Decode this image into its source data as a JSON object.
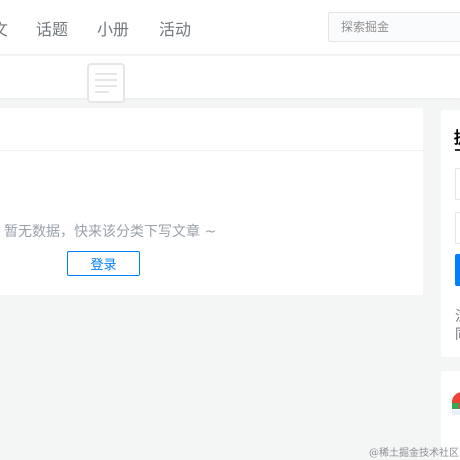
{
  "nav": {
    "edge_label": "文",
    "links": [
      {
        "label": "话题"
      },
      {
        "label": "小册"
      },
      {
        "label": "活动"
      }
    ],
    "search_placeholder": "探索掘金"
  },
  "main": {
    "empty_text": "暂无数据，快来该分类下写文章 ~",
    "login_label": "登录"
  },
  "sidebar": {
    "card_title": "提",
    "line_1": "注",
    "line_2": "同"
  },
  "watermark": "@稀土掘金技术社区"
}
